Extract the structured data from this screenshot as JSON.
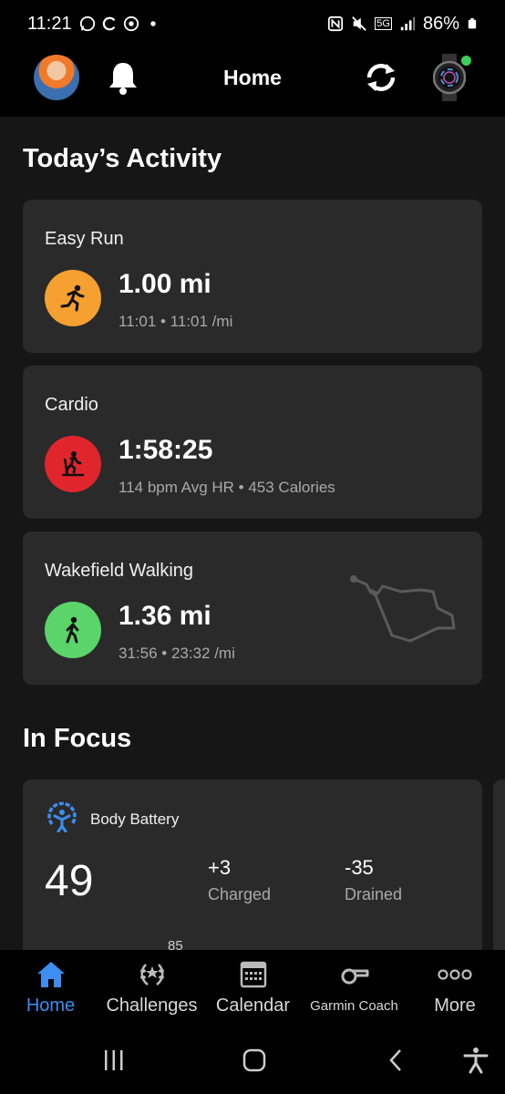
{
  "status_bar": {
    "time": "11:21",
    "battery": "86%",
    "network": "5G",
    "icons": [
      "whatsapp-icon",
      "sync-status-icon",
      "chrome-icon",
      "dot-icon",
      "nfc-icon",
      "mute-icon",
      "signal-icon",
      "battery-icon"
    ]
  },
  "header": {
    "title": "Home",
    "icons": [
      "avatar",
      "bell-icon",
      "sync-icon",
      "watch-icon"
    ],
    "connected_color": "#3bd05b"
  },
  "today": {
    "title": "Today’s Activity",
    "activities": [
      {
        "name": "Easy Run",
        "value": "1.00 mi",
        "detail": "11:01 • 11:01 /mi",
        "icon": "running-icon",
        "color": "#f5a030"
      },
      {
        "name": "Cardio",
        "value": "1:58:25",
        "detail": "114 bpm Avg HR • 453 Calories",
        "icon": "treadmill-icon",
        "color": "#e0262c"
      },
      {
        "name": "Wakefield Walking",
        "value": "1.36 mi",
        "detail": "31:56 • 23:32 /mi",
        "icon": "walking-icon",
        "color": "#5bd46a",
        "has_route_map": true
      }
    ]
  },
  "focus": {
    "title": "In Focus",
    "body_battery": {
      "title": "Body Battery",
      "value": "49",
      "charged_value": "+3",
      "charged_label": "Charged",
      "drained_value": "-35",
      "drained_label": "Drained",
      "peak": "85",
      "icon": "body-battery-icon",
      "accent": "#3d8ef0"
    }
  },
  "bottom_nav": {
    "items": [
      {
        "label": "Home",
        "icon": "home-icon",
        "active": true
      },
      {
        "label": "Challenges",
        "icon": "laurel-icon",
        "active": false
      },
      {
        "label": "Calendar",
        "icon": "calendar-icon",
        "active": false
      },
      {
        "label": "Garmin Coach",
        "icon": "whistle-icon",
        "active": false
      },
      {
        "label": "More",
        "icon": "more-icon",
        "active": false
      }
    ]
  },
  "system_nav": [
    "recents-icon",
    "home-button-icon",
    "back-icon",
    "accessibility-icon"
  ]
}
